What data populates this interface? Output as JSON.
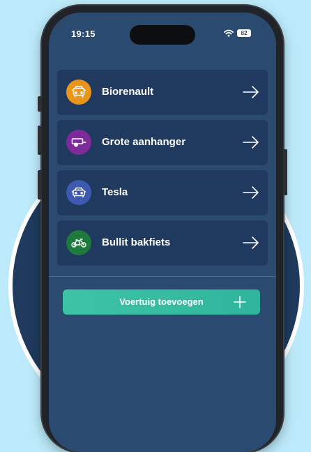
{
  "status_bar": {
    "time": "19:15",
    "battery": "82",
    "signal_icon": "wifi-icon"
  },
  "vehicles": [
    {
      "name": "Biorenault",
      "icon": "car-icon",
      "color": "#e8951b"
    },
    {
      "name": "Grote aanhanger",
      "icon": "trailer-icon",
      "color": "#7d2a9b"
    },
    {
      "name": "Tesla",
      "icon": "car-icon",
      "color": "#3e5ab0"
    },
    {
      "name": "Bullit bakfiets",
      "icon": "cargo-bike-icon",
      "color": "#1e7a3c"
    }
  ],
  "add_button": {
    "label": "Voertuig toevoegen",
    "icon": "plus-icon"
  },
  "colors": {
    "background": "#bdeafb",
    "screen": "#2b4a70",
    "card": "#203a5f",
    "accent": "#3ec3a7"
  }
}
